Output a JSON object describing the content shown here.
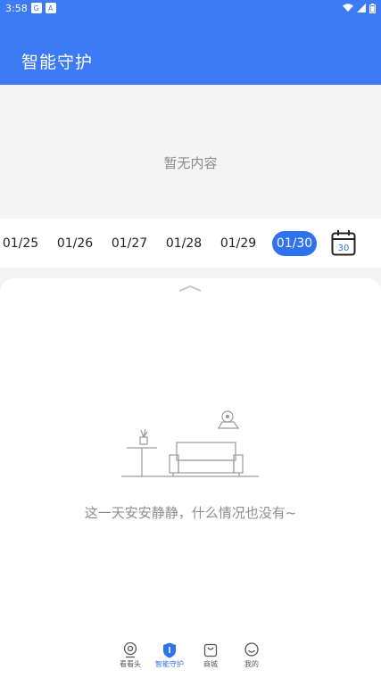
{
  "status_bar": {
    "time": "3:58"
  },
  "header": {
    "title": "智能守护"
  },
  "video_area": {
    "empty_text": "暂无内容"
  },
  "dates": [
    {
      "label": "01/25",
      "selected": false
    },
    {
      "label": "01/26",
      "selected": false
    },
    {
      "label": "01/27",
      "selected": false
    },
    {
      "label": "01/28",
      "selected": false
    },
    {
      "label": "01/29",
      "selected": false
    },
    {
      "label": "01/30",
      "selected": true
    }
  ],
  "calendar": {
    "day": "30"
  },
  "sheet": {
    "empty_text": "这一天安安静静，什么情况也没有~"
  },
  "tabs": [
    {
      "label": "看看头",
      "active": false
    },
    {
      "label": "智能守护",
      "active": true
    },
    {
      "label": "商城",
      "active": false
    },
    {
      "label": "我的",
      "active": false
    }
  ],
  "colors": {
    "primary": "#3d7af6",
    "selected_date": "#2f72f0"
  }
}
